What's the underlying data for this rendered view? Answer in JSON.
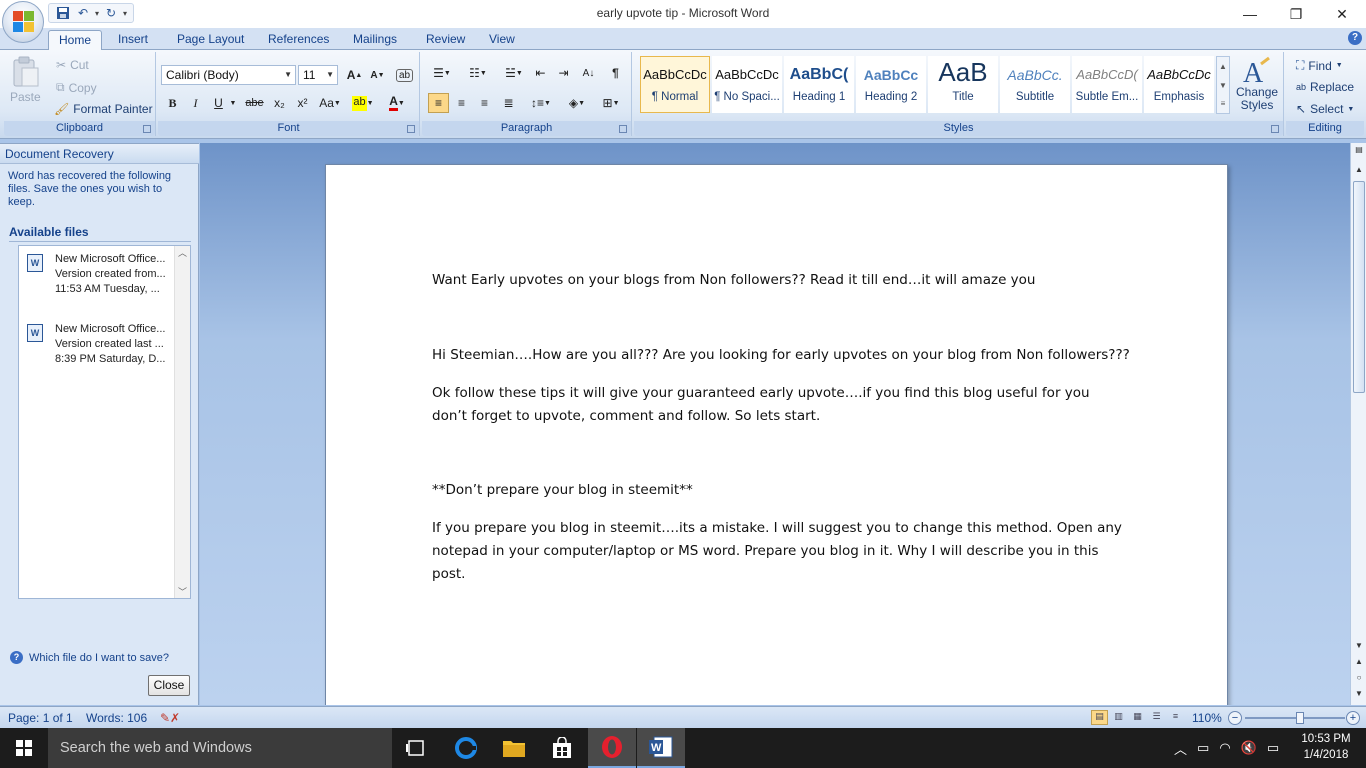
{
  "window": {
    "title": "early upvote tip - Microsoft Word",
    "minimize": "—",
    "maximize": "❐",
    "close": "✕"
  },
  "tabs": [
    "Home",
    "Insert",
    "Page Layout",
    "References",
    "Mailings",
    "Review",
    "View"
  ],
  "clipboard": {
    "paste": "Paste",
    "cut": "Cut",
    "copy": "Copy",
    "format_painter": "Format Painter",
    "label": "Clipboard"
  },
  "font": {
    "family": "Calibri (Body)",
    "size": "11",
    "bold": "B",
    "italic": "I",
    "underline": "U",
    "strike": "abe",
    "subscript": "x₂",
    "superscript": "x²",
    "change_case": "Aa",
    "grow": "A",
    "shrink": "A",
    "label": "Font"
  },
  "paragraph": {
    "label": "Paragraph"
  },
  "styles": {
    "label": "Styles",
    "items": [
      {
        "sample": "AaBbCcDc",
        "name": "¶ Normal"
      },
      {
        "sample": "AaBbCcDc",
        "name": "¶ No Spaci..."
      },
      {
        "sample": "AaBbC(",
        "name": "Heading 1"
      },
      {
        "sample": "AaBbCc",
        "name": "Heading 2"
      },
      {
        "sample": "AaB",
        "name": "Title"
      },
      {
        "sample": "AaBbCc.",
        "name": "Subtitle"
      },
      {
        "sample": "AaBbCcD(",
        "name": "Subtle Em..."
      },
      {
        "sample": "AaBbCcDc",
        "name": "Emphasis"
      }
    ],
    "change_styles_1": "Change",
    "change_styles_2": "Styles"
  },
  "editing": {
    "find": "Find",
    "replace": "Replace",
    "select": "Select",
    "label": "Editing"
  },
  "recovery": {
    "title": "Document Recovery",
    "message": "Word has recovered the following files.  Save the ones you wish to keep.",
    "available": "Available files",
    "files": [
      {
        "name": "New Microsoft Office...",
        "version": "Version created from...",
        "time": "11:53 AM Tuesday, ..."
      },
      {
        "name": "New Microsoft Office...",
        "version": "Version created last ...",
        "time": "8:39 PM Saturday, D..."
      }
    ],
    "help": "Which file do I want to save?",
    "close": "Close"
  },
  "document": {
    "p1": "Want Early upvotes on your blogs from Non followers?? Read it till end…it will amaze you",
    "p2": "Hi Steemian….How are you all??? Are you looking for early upvotes on your blog from Non followers???",
    "p3": "Ok follow these tips it will give your guaranteed early upvote….if you find this blog useful for you don’t forget to upvote, comment and follow. So lets start.",
    "p4": "**Don’t prepare your blog in steemit**",
    "p5": "If you prepare you blog in steemit….its a mistake. I will suggest you to change this method. Open any notepad in your computer/laptop or MS word. Prepare you blog in it. Why I will describe you in this post."
  },
  "status": {
    "page": "Page: 1 of 1",
    "words": "Words: 106",
    "zoom": "110%",
    "zoom_minus": "−",
    "zoom_plus": "+",
    "zoom_fraction": 0.55
  },
  "taskbar": {
    "search_placeholder": "Search the web and Windows",
    "time": "10:53 PM",
    "date": "1/4/2018"
  },
  "colors": {
    "ribbon_text": "#15428b",
    "word_blue": "#2b5797",
    "opera_red": "#e5202e",
    "edge_blue": "#1e88e5",
    "folder_yellow": "#f2c232"
  }
}
